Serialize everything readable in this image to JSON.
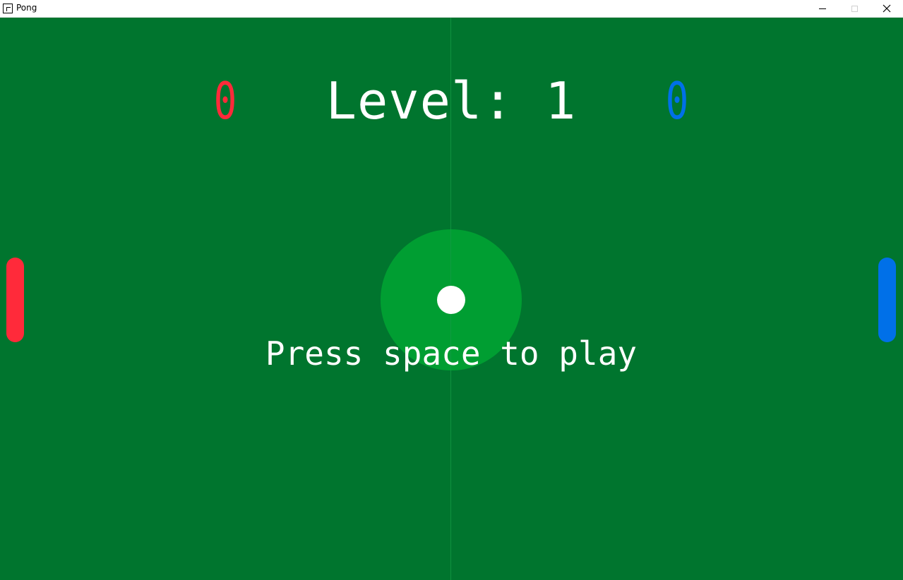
{
  "window": {
    "title": "Pong",
    "icon": "app-window-icon",
    "controls": [
      "minimize-icon",
      "maximize-icon",
      "close-icon"
    ]
  },
  "game": {
    "level_text": "Level: 1",
    "prompt_text": "Press space to play",
    "left_score": "0",
    "right_score": "0"
  },
  "colors": {
    "field": "#00752e",
    "center_circle": "#009e32",
    "left_player": "#ff2a3a",
    "right_player": "#0070e8",
    "ball": "#ffffff",
    "text": "#ffffff"
  }
}
